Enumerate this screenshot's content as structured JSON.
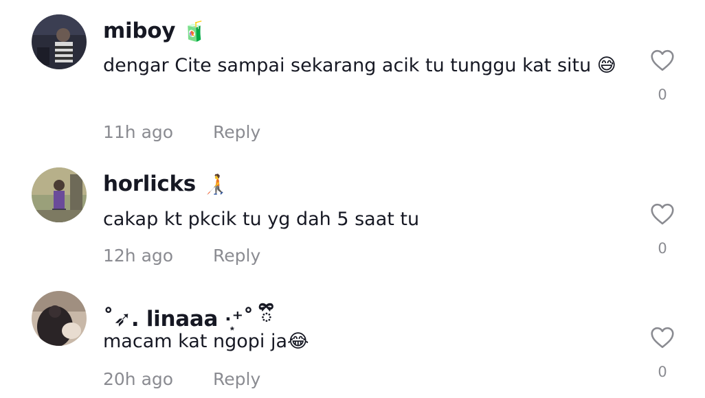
{
  "comments": [
    {
      "username": "miboy",
      "badge": "🧃",
      "text": "dengar Cite sampai sekarang acik tu tunggu kat situ 😅",
      "time": "11h ago",
      "reply": "Reply",
      "likes": "0",
      "icon": "heart-outline-icon"
    },
    {
      "username": "horlicks",
      "badge": "🧑‍🦯",
      "text": "cakap kt pkcik tu yg dah 5 saat tu",
      "time": "12h ago",
      "reply": "Reply",
      "likes": "0",
      "icon": "heart-outline-icon"
    },
    {
      "username": "˚➶. linaaa ·͙⁺˚ ྀི",
      "badge": "",
      "text": "macam kat ngopi ja😂",
      "time": "20h ago",
      "reply": "Reply",
      "likes": "0",
      "icon": "heart-outline-icon"
    }
  ],
  "colors": {
    "text": "#161823",
    "muted": "#8a8b91",
    "background": "#ffffff"
  }
}
